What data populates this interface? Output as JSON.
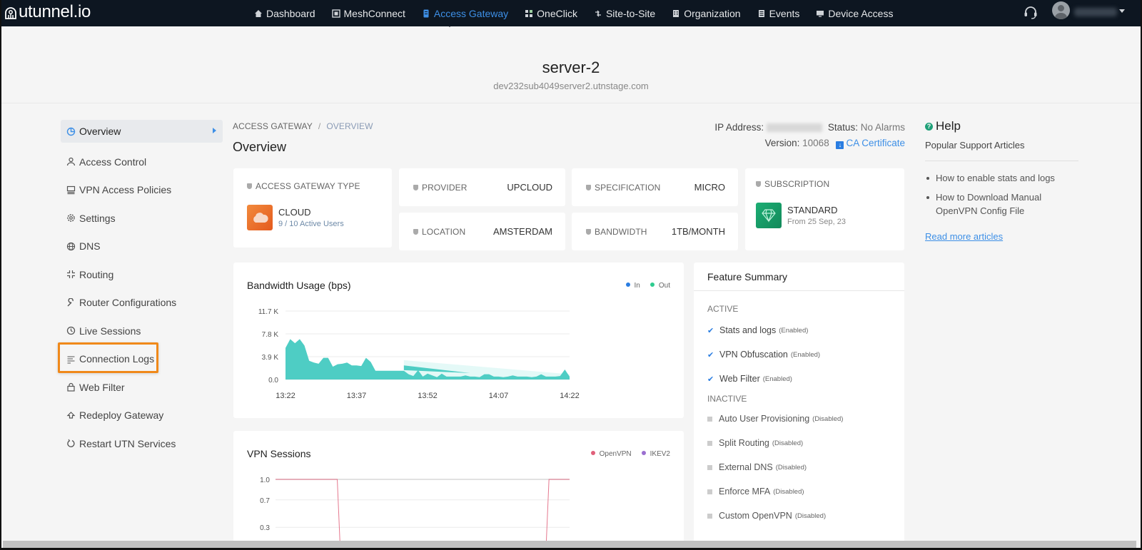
{
  "app": {
    "logo_text": "utunnel.io"
  },
  "nav": {
    "items": [
      {
        "label": "Dashboard",
        "icon": "home-icon",
        "active": false
      },
      {
        "label": "MeshConnect",
        "icon": "mesh-icon",
        "active": false
      },
      {
        "label": "Access Gateway",
        "icon": "server-icon",
        "active": true
      },
      {
        "label": "OneClick",
        "icon": "grid-icon",
        "active": false
      },
      {
        "label": "Site-to-Site",
        "icon": "arrows-icon",
        "active": false
      },
      {
        "label": "Organization",
        "icon": "building-icon",
        "active": false
      },
      {
        "label": "Events",
        "icon": "list-icon",
        "active": false
      },
      {
        "label": "Device Access",
        "icon": "monitor-icon",
        "active": false
      }
    ],
    "support_icon": "headset-icon",
    "user_icon": "avatar-icon"
  },
  "header": {
    "server_name": "server-2",
    "hostname": "dev232sub4049server2.utnstage.com"
  },
  "sidebar": {
    "items": [
      {
        "label": "Overview",
        "icon": "pie-chart-icon",
        "active": true
      },
      {
        "label": "Access Control",
        "icon": "user-icon"
      },
      {
        "label": "VPN Access Policies",
        "icon": "policy-icon"
      },
      {
        "label": "Settings",
        "icon": "gear-icon"
      },
      {
        "label": "DNS",
        "icon": "globe-icon"
      },
      {
        "label": "Routing",
        "icon": "routing-icon"
      },
      {
        "label": "Router Configurations",
        "icon": "wrench-icon"
      },
      {
        "label": "Live Sessions",
        "icon": "clock-icon"
      },
      {
        "label": "Connection Logs",
        "icon": "lines-icon",
        "highlighted": true
      },
      {
        "label": "Web Filter",
        "icon": "lock-icon"
      },
      {
        "label": "Redeploy Gateway",
        "icon": "redeploy-icon"
      },
      {
        "label": "Restart UTN Services",
        "icon": "restart-icon"
      }
    ]
  },
  "breadcrumb": {
    "parent": "ACCESS GATEWAY",
    "separator": "/",
    "current": "OVERVIEW"
  },
  "main": {
    "title": "Overview",
    "ip_label": "IP Address:",
    "status_label": "Status:",
    "status_value": "No Alarms",
    "version_label": "Version:",
    "version_value": "10068",
    "ca_cert_label": "CA Certificate"
  },
  "cards": {
    "gateway_type": {
      "label": "ACCESS GATEWAY TYPE",
      "value": "CLOUD",
      "sub": "9 / 10 Active Users"
    },
    "provider": {
      "label": "PROVIDER",
      "value": "UPCLOUD"
    },
    "location": {
      "label": "LOCATION",
      "value": "AMSTERDAM"
    },
    "specification": {
      "label": "SPECIFICATION",
      "value": "MICRO"
    },
    "bandwidth": {
      "label": "BANDWIDTH",
      "value": "1TB/MONTH"
    },
    "subscription": {
      "label": "SUBSCRIPTION",
      "value": "STANDARD",
      "sub": "From 25 Sep, 23"
    }
  },
  "feature_summary": {
    "title": "Feature Summary",
    "active_label": "ACTIVE",
    "active": [
      {
        "name": "Stats and logs",
        "state": "(Enabled)"
      },
      {
        "name": "VPN Obfuscation",
        "state": "(Enabled)"
      },
      {
        "name": "Web Filter",
        "state": "(Enabled)"
      }
    ],
    "inactive_label": "INACTIVE",
    "inactive": [
      {
        "name": "Auto User Provisioning",
        "state": "(Disabled)"
      },
      {
        "name": "Split Routing",
        "state": "(Disabled)"
      },
      {
        "name": "External DNS",
        "state": "(Disabled)"
      },
      {
        "name": "Enforce MFA",
        "state": "(Disabled)"
      },
      {
        "name": "Custom OpenVPN",
        "state": "(Disabled)"
      }
    ]
  },
  "help": {
    "title": "Help",
    "subtitle": "Popular Support Articles",
    "articles": [
      "How to enable stats and logs",
      "How to Download Manual OpenVPN Config File"
    ],
    "more_link": "Read more articles"
  },
  "colors": {
    "accent": "#3d8fe6",
    "nav_bg": "#0d1621",
    "highlight": "#f0891a",
    "area_fill": "#4ecdc4",
    "in_series": "#2a7de1",
    "out_series": "#2ecc8f",
    "openvpn": "#e0607a",
    "ikev2": "#9b6fd0"
  },
  "chart_data": [
    {
      "type": "area",
      "title": "Bandwidth Usage (bps)",
      "xlabel": "",
      "ylabel": "",
      "x_ticks": [
        "13:22",
        "13:37",
        "13:52",
        "14:07",
        "14:22"
      ],
      "y_ticks": [
        "0.0",
        "3.9 K",
        "7.8 K",
        "11.7 K"
      ],
      "ylim": [
        0,
        11700
      ],
      "grid": true,
      "legend": {
        "position": "top-right",
        "entries": [
          "In",
          "Out"
        ]
      },
      "x_minutes": [
        0,
        1,
        2,
        3,
        4,
        5,
        6,
        7,
        8,
        9,
        10,
        11,
        12,
        13,
        14,
        15,
        16,
        17,
        18,
        19,
        20,
        21,
        22,
        23,
        24,
        25,
        26,
        27,
        28,
        29,
        30,
        31,
        32,
        33,
        34,
        35,
        36,
        37,
        38,
        39,
        40,
        41,
        42,
        43,
        44,
        45,
        46,
        47,
        48,
        49,
        50,
        51,
        52,
        53,
        54,
        55,
        56,
        57,
        58,
        59,
        60
      ],
      "series": [
        {
          "name": "Out",
          "values": [
            5400,
            6900,
            6200,
            6900,
            5800,
            3200,
            2900,
            2700,
            3700,
            3700,
            2200,
            2600,
            2700,
            2900,
            2400,
            2400,
            2300,
            3700,
            3000,
            1500,
            1500,
            1500,
            1500,
            1500,
            1500,
            1500,
            900,
            600,
            1600,
            500,
            1000,
            700,
            400,
            1000,
            500,
            500,
            500,
            500,
            700,
            500,
            500,
            400,
            900,
            900,
            500,
            500,
            400,
            500,
            700,
            500,
            500,
            500,
            400,
            500,
            900,
            500,
            500,
            500,
            600,
            1700,
            500
          ]
        }
      ]
    },
    {
      "type": "line",
      "title": "VPN Sessions",
      "y_ticks": [
        "0.3",
        "0.7",
        "1.0"
      ],
      "ylim": [
        0,
        1.0
      ],
      "grid": true,
      "legend": {
        "position": "top-right",
        "entries": [
          "OpenVPN",
          "IKEV2"
        ]
      },
      "series": [
        {
          "name": "OpenVPN",
          "x_fraction": [
            0,
            0.21,
            0.22,
            0.92,
            0.93,
            1.0
          ],
          "values": [
            1.0,
            1.0,
            0.0,
            0.0,
            1.0,
            1.0
          ]
        },
        {
          "name": "IKEV2",
          "x_fraction": [],
          "values": []
        }
      ]
    }
  ]
}
